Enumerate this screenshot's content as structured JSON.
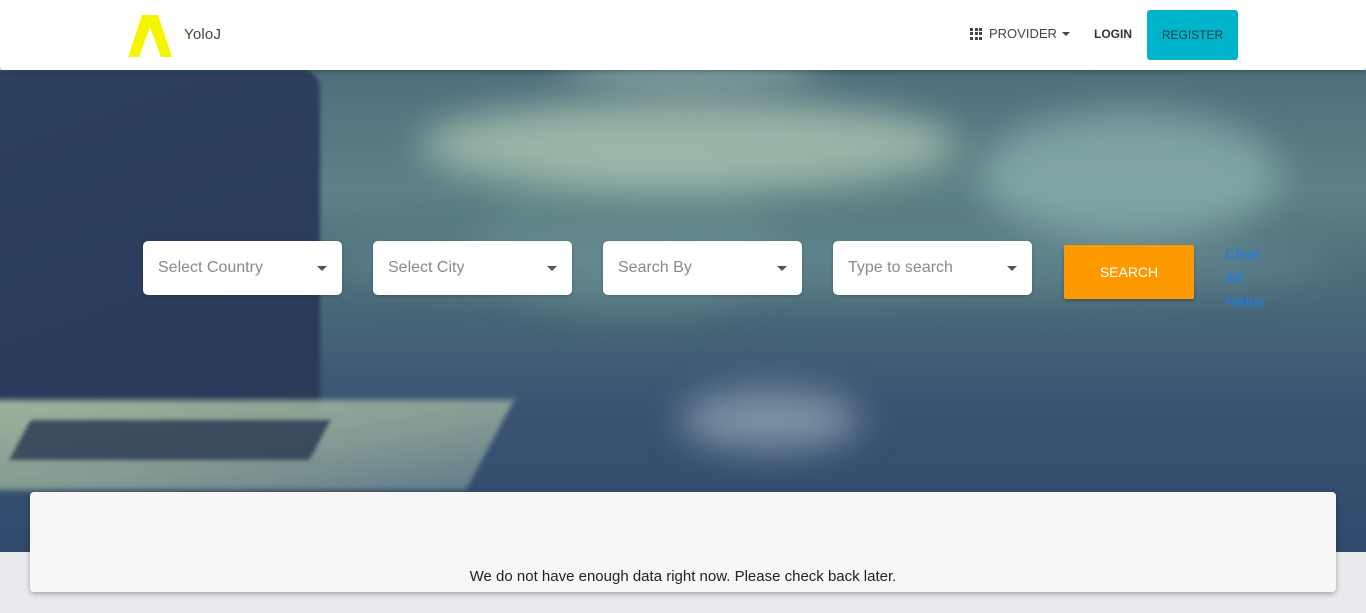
{
  "header": {
    "brand": "YoloJ",
    "provider_label": "PROVIDER",
    "login_label": "LOGIN",
    "register_label": "REGISTER",
    "colors": {
      "logo": "#f5f500",
      "register_bg": "#00b4cc"
    },
    "icons": [
      "logo-icon",
      "grid-icon",
      "caret-down-icon"
    ]
  },
  "search": {
    "country_placeholder": "Select Country",
    "city_placeholder": "Select City",
    "search_by_placeholder": "Search By",
    "type_placeholder": "Type to search",
    "search_button": "SEARCH",
    "clear_link": "Clear All Fields",
    "colors": {
      "search_button": "#ff9900",
      "clear_link": "#1a7af0"
    }
  },
  "results": {
    "message": "We do not have enough data right now. Please check back later."
  }
}
